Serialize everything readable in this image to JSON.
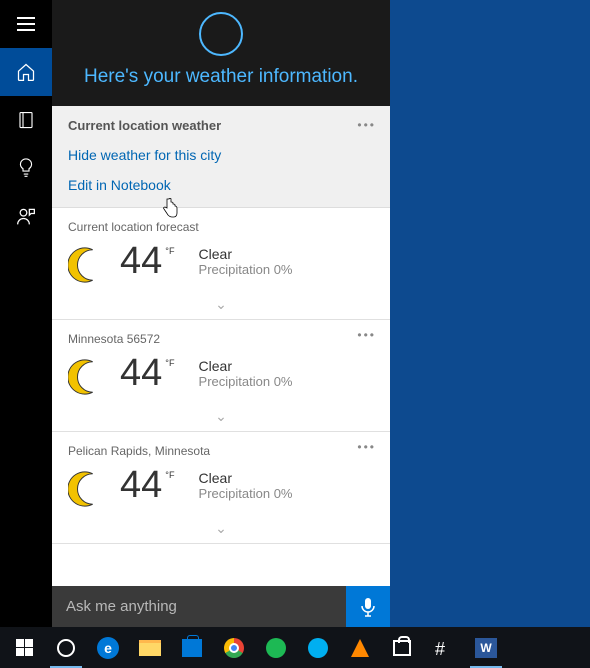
{
  "sidebar": {
    "items": [
      "menu",
      "home",
      "notebook",
      "insights",
      "feedback"
    ]
  },
  "header": {
    "title": "Here's your weather information."
  },
  "settings": {
    "title": "Current location weather",
    "hide_link": "Hide weather for this city",
    "edit_link": "Edit in Notebook"
  },
  "forecasts": [
    {
      "location": "Current location forecast",
      "temp": "44",
      "unit": "°F",
      "condition": "Clear",
      "precipitation": "Precipitation 0%",
      "show_dots": false
    },
    {
      "location": "Minnesota 56572",
      "temp": "44",
      "unit": "°F",
      "condition": "Clear",
      "precipitation": "Precipitation 0%",
      "show_dots": true
    },
    {
      "location": "Pelican Rapids, Minnesota",
      "temp": "44",
      "unit": "°F",
      "condition": "Clear",
      "precipitation": "Precipitation 0%",
      "show_dots": true
    }
  ],
  "search": {
    "placeholder": "Ask me anything"
  },
  "taskbar": {
    "items": [
      "start",
      "cortana",
      "edge",
      "file-explorer",
      "store",
      "chrome",
      "spotify",
      "skype",
      "vlc",
      "shopping",
      "slack",
      "word"
    ]
  }
}
